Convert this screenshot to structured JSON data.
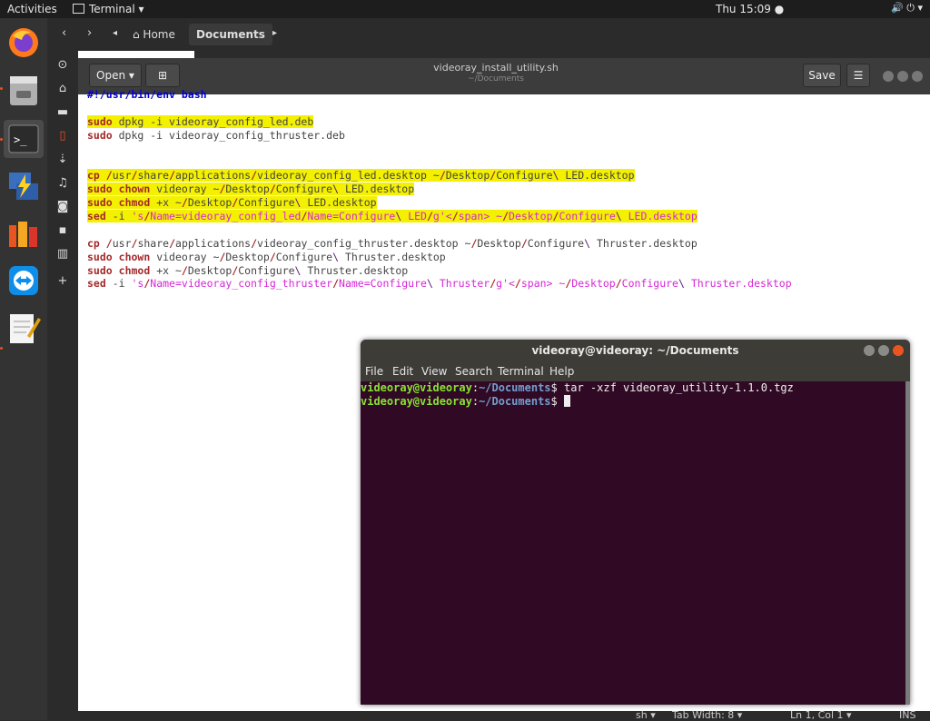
{
  "topbar": {
    "activities": "Activities",
    "app": "Terminal ▾",
    "clock": "Thu 15:09 ●"
  },
  "nautilus": {
    "crumbs": [
      "⌂ Home",
      "Documents"
    ]
  },
  "gedit": {
    "open_label": "Open ▾",
    "save_label": "Save",
    "menu_label": "☰",
    "title": "videoray_install_utility.sh",
    "subtitle": "~/Documents",
    "status": {
      "lang": "sh ▾",
      "tab": "Tab Width: 8 ▾",
      "pos": "Ln 1, Col 1 ▾",
      "mode": "INS"
    },
    "lines": [
      "#!/usr/bin/env bash",
      "",
      "sudo dpkg -i videoray_config_led.deb",
      "sudo dpkg -i videoray_config_thruster.deb",
      "",
      "",
      "cp /usr/share/applications/videoray_config_led.desktop ~/Desktop/Configure\\ LED.desktop",
      "sudo chown videoray ~/Desktop/Configure\\ LED.desktop",
      "sudo chmod +x ~/Desktop/Configure\\ LED.desktop",
      "sed -i 's/Name=videoray_config_led/Name=Configure\\ LED/g' ~/Desktop/Configure\\ LED.desktop",
      "",
      "cp /usr/share/applications/videoray_config_thruster.desktop ~/Desktop/Configure\\ Thruster.desktop",
      "sudo chown videoray ~/Desktop/Configure\\ Thruster.desktop",
      "sudo chmod +x ~/Desktop/Configure\\ Thruster.desktop",
      "sed -i 's/Name=videoray_config_thruster/Name=Configure\\ Thruster/g' ~/Desktop/Configure\\ Thruster.desktop"
    ]
  },
  "terminal": {
    "title": "videoray@videoray: ~/Documents",
    "menu": [
      "File",
      "Edit",
      "View",
      "Search",
      "Terminal",
      "Help"
    ],
    "prompt_user": "videoray@videoray",
    "prompt_path": "~/Documents",
    "lines": [
      {
        "cmd": "tar -xzf videoray_utility-1.1.0.tgz"
      },
      {
        "cmd": ""
      }
    ]
  },
  "colors": {
    "ubuntu_orange": "#e95420",
    "terminal_bg": "#300a24",
    "highlight": "#f3f000"
  }
}
